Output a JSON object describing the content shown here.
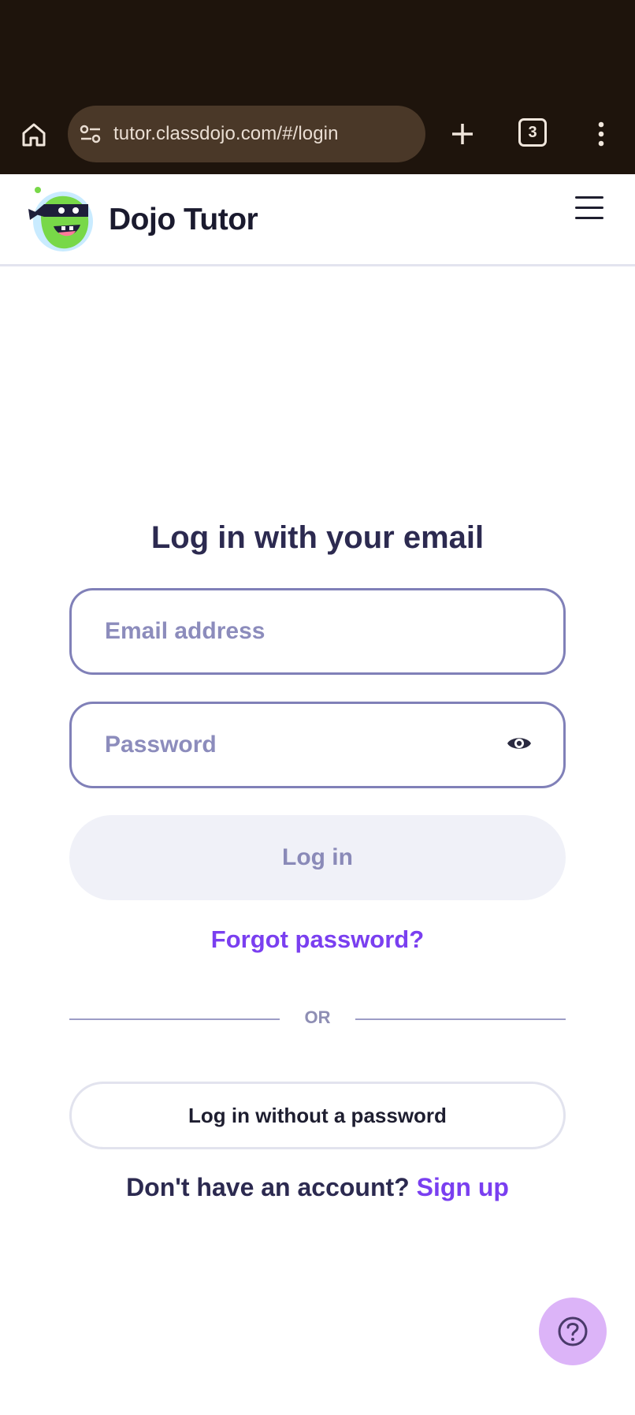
{
  "browser": {
    "url": "tutor.classdojo.com/#/login",
    "tab_count": "3",
    "icons": [
      "home-icon",
      "site-settings-icon",
      "new-tab-icon",
      "tab-switcher-icon",
      "more-menu-icon"
    ]
  },
  "header": {
    "brand": "Dojo Tutor",
    "logo": "dojo-monster-logo",
    "menu_icon": "hamburger-menu-icon"
  },
  "login": {
    "title": "Log in with your email",
    "email_placeholder": "Email address",
    "password_placeholder": "Password",
    "login_button": "Log in",
    "forgot_password": "Forgot password?",
    "divider": "OR",
    "no_password_button": "Log in without a password",
    "signup_prompt": "Don't have an account?",
    "signup_link": "Sign up"
  },
  "help": {
    "icon": "help-question-icon"
  },
  "colors": {
    "chrome_bg": "#1e140c",
    "accent_purple": "#7a3ff0",
    "title_navy": "#2c2a50",
    "field_border": "#8080b8",
    "help_bg": "#dcb4f8"
  }
}
